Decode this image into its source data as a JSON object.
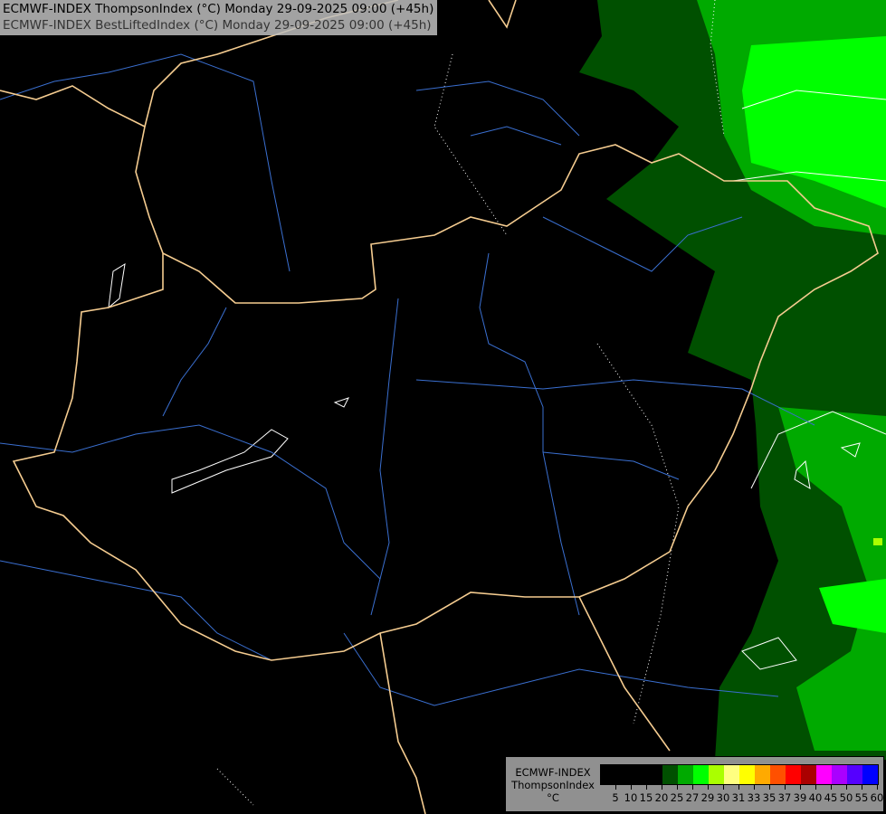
{
  "titles": [
    "ECMWF-INDEX ThompsonIndex (°C) Monday 29-09-2025 09:00 (+45h)",
    "ECMWF-INDEX BestLiftedIndex (°C) Monday 29-09-2025 09:00 (+45h)"
  ],
  "legend": {
    "model": "ECMWF-INDEX",
    "parameter": "ThompsonIndex",
    "unit": "°C",
    "labels": [
      "5",
      "10",
      "15",
      "20",
      "25",
      "27",
      "29",
      "30",
      "31",
      "33",
      "35",
      "37",
      "39",
      "40",
      "45",
      "50",
      "55",
      "60"
    ],
    "colors": [
      "#000000",
      "#000000",
      "#000000",
      "#000000",
      "#005000",
      "#00aa00",
      "#00ff00",
      "#aaff00",
      "#ffff80",
      "#ffff00",
      "#ffaa00",
      "#ff5000",
      "#ff0000",
      "#aa0000",
      "#ff00ff",
      "#aa00ff",
      "#5500ff",
      "#0000ff"
    ]
  },
  "map_colors": {
    "border": "#f5cc90",
    "river": "#3a6fd0",
    "contour": "#ffffff"
  }
}
